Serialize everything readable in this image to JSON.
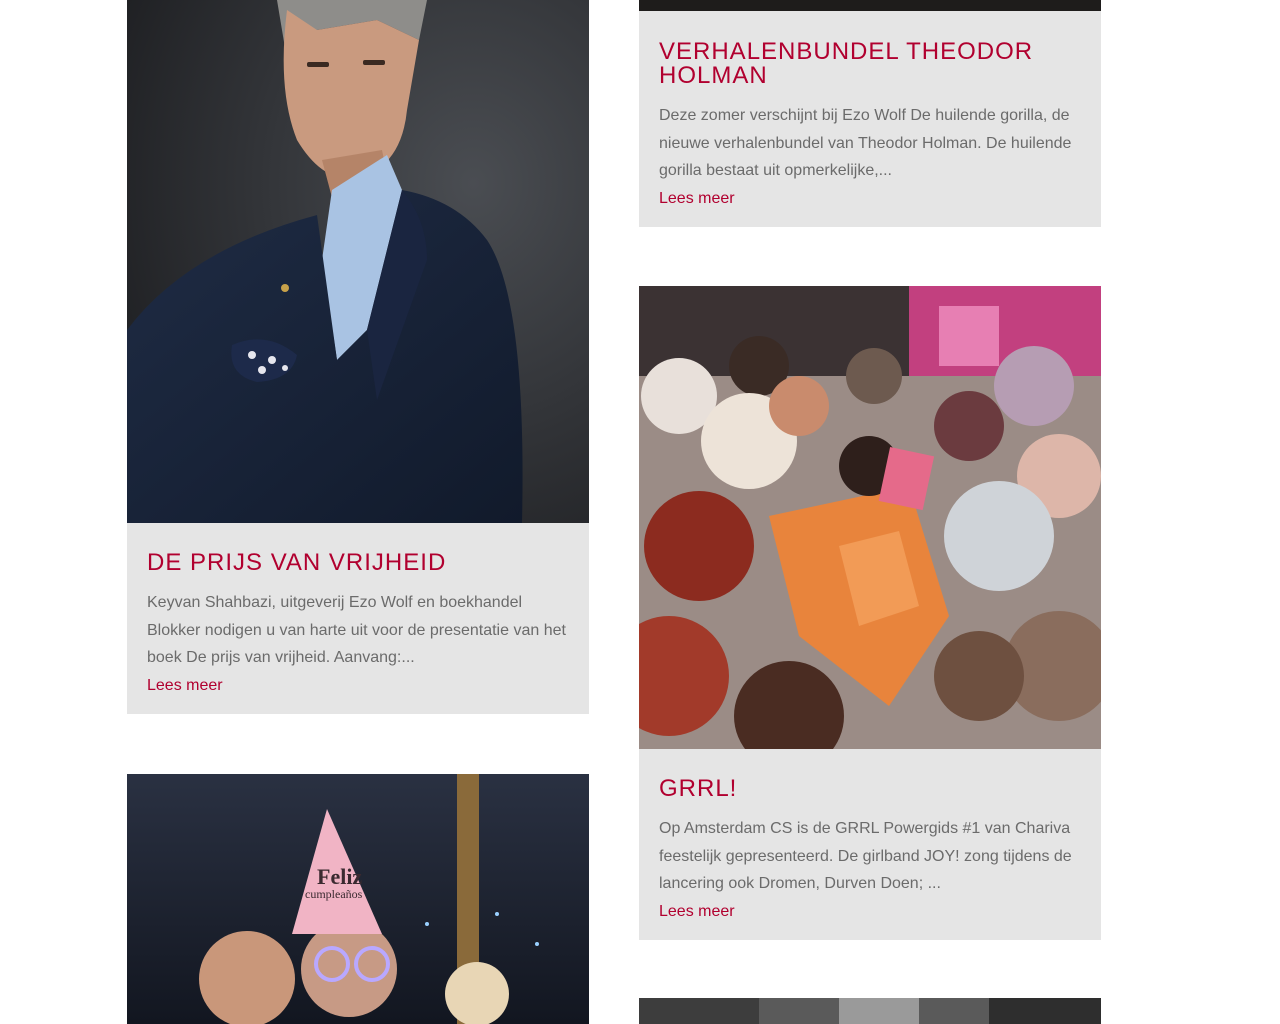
{
  "posts": [
    {
      "title": "Verhalenbundel Theodor Holman",
      "excerpt": "Deze zomer verschijnt bij Ezo Wolf De huilende gorilla, de nieuwe verhalenbundel van Theodor Holman. De huilende gorilla bestaat uit opmerkelijke,...",
      "read_more": "Lees meer"
    },
    {
      "title": "De prijs van vrijheid",
      "excerpt": "Keyvan Shahbazi, uitgeverij Ezo Wolf en boekhandel Blokker nodigen u van harte uit voor de presentatie van het boek De prijs van vrijheid. Aanvang:...",
      "read_more": "Lees meer"
    },
    {
      "title": "GRRL!",
      "excerpt": "Op Amsterdam CS is de GRRL Powergids #1 van Chariva feestelijk gepresenteerd. De girlband JOY! zong tijdens de lancering ook Dromen, Durven Doen; ...",
      "read_more": "Lees meer"
    }
  ],
  "images": {
    "party_hat_text": "Feliz",
    "party_hat_text2": "cumpleaños"
  },
  "colors": {
    "accent": "#b1002f",
    "card_bg": "#e5e5e5",
    "text": "#6b6b6b"
  }
}
